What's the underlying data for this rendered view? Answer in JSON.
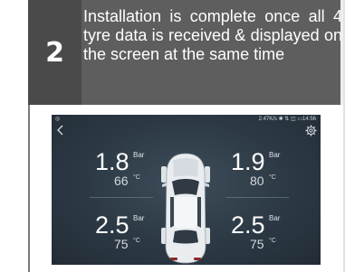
{
  "instruction": {
    "step": "2",
    "text": "Installation is complete once all 4 tyre data is received & displayed on the screen at the same time"
  },
  "screen": {
    "status_left": "◎",
    "status_right": "2.47K/s ✱ ⇅ ◫ ▭14:56",
    "units": {
      "pressure": "Bar",
      "temperature": "°C"
    },
    "tyres": {
      "front_left": {
        "pressure": "1.8",
        "temperature": "66"
      },
      "front_right": {
        "pressure": "1.9",
        "temperature": "80"
      },
      "rear_left": {
        "pressure": "2.5",
        "temperature": "75"
      },
      "rear_right": {
        "pressure": "2.5",
        "temperature": "75"
      }
    },
    "icons": [
      "back-icon",
      "settings-icon",
      "car-top-view-icon"
    ],
    "colors": {
      "background": "#2c3945",
      "text": "#ffffff",
      "banner": "#5e5e5e"
    }
  }
}
